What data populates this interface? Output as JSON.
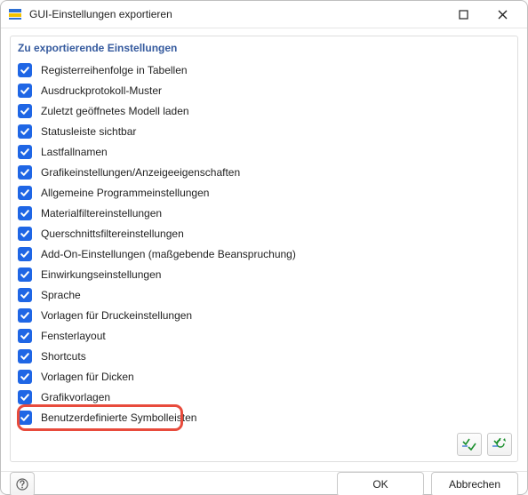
{
  "window": {
    "title": "GUI-Einstellungen exportieren"
  },
  "group": {
    "header": "Zu exportierende Einstellungen"
  },
  "items": [
    {
      "label": "Registerreihenfolge in Tabellen",
      "checked": true
    },
    {
      "label": "Ausdruckprotokoll-Muster",
      "checked": true
    },
    {
      "label": "Zuletzt geöffnetes Modell laden",
      "checked": true
    },
    {
      "label": "Statusleiste sichtbar",
      "checked": true
    },
    {
      "label": "Lastfallnamen",
      "checked": true
    },
    {
      "label": "Grafikeinstellungen/Anzeigeeigenschaften",
      "checked": true
    },
    {
      "label": "Allgemeine Programmeinstellungen",
      "checked": true
    },
    {
      "label": "Materialfiltereinstellungen",
      "checked": true
    },
    {
      "label": "Querschnittsfiltereinstellungen",
      "checked": true
    },
    {
      "label": "Add-On-Einstellungen (maßgebende Beanspruchung)",
      "checked": true
    },
    {
      "label": "Einwirkungseinstellungen",
      "checked": true
    },
    {
      "label": "Sprache",
      "checked": true
    },
    {
      "label": "Vorlagen für Druckeinstellungen",
      "checked": true
    },
    {
      "label": "Fensterlayout",
      "checked": true
    },
    {
      "label": "Shortcuts",
      "checked": true
    },
    {
      "label": "Vorlagen für Dicken",
      "checked": true
    },
    {
      "label": "Grafikvorlagen",
      "checked": true
    },
    {
      "label": "Benutzerdefinierte Symbolleisten",
      "checked": true,
      "highlighted": true
    }
  ],
  "footer": {
    "ok": "OK",
    "cancel": "Abbrechen"
  }
}
